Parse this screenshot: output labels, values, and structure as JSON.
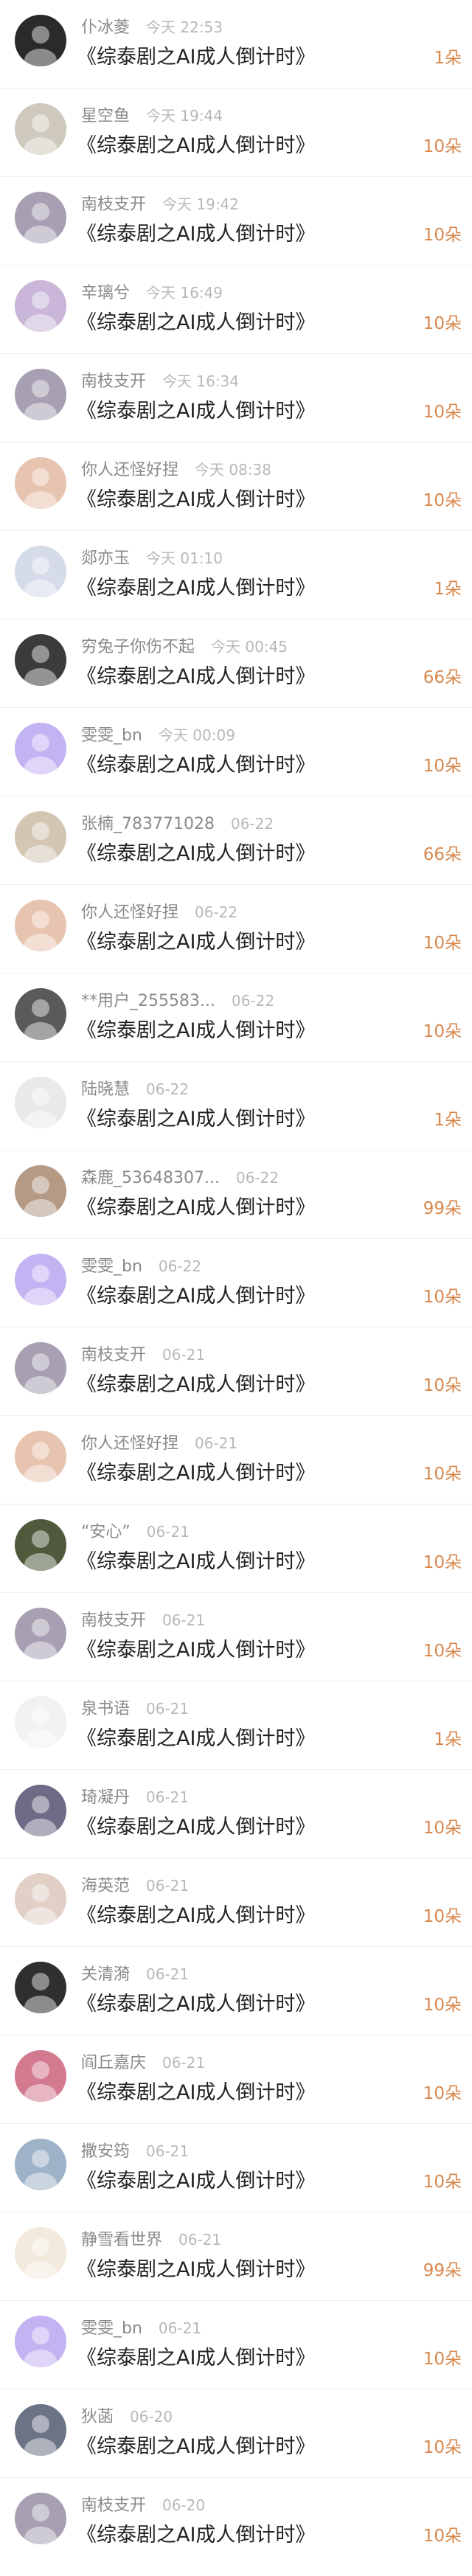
{
  "colors": {
    "gift_accent": "#d8874c",
    "name": "#8a8a8a",
    "time": "#b8b8b8",
    "title": "#222222"
  },
  "items": [
    {
      "name": "仆冰菱",
      "time": "今天 22:53",
      "title": "《综泰剧之AI成人倒计时》",
      "gift": "1朵",
      "avatar": "#2a2a2a"
    },
    {
      "name": "星空鱼",
      "time": "今天 19:44",
      "title": "《综泰剧之AI成人倒计时》",
      "gift": "10朵",
      "avatar": "#cfc8bd"
    },
    {
      "name": "南枝支开",
      "time": "今天 19:42",
      "title": "《综泰剧之AI成人倒计时》",
      "gift": "10朵",
      "avatar": "#a7a0b2"
    },
    {
      "name": "辛璃兮",
      "time": "今天 16:49",
      "title": "《综泰剧之AI成人倒计时》",
      "gift": "10朵",
      "avatar": "#c9b6d9"
    },
    {
      "name": "南枝支开",
      "time": "今天 16:34",
      "title": "《综泰剧之AI成人倒计时》",
      "gift": "10朵",
      "avatar": "#a7a0b2"
    },
    {
      "name": "你人还怪好捏",
      "time": "今天 08:38",
      "title": "《综泰剧之AI成人倒计时》",
      "gift": "10朵",
      "avatar": "#e7c4b0"
    },
    {
      "name": "郯亦玉",
      "time": "今天 01:10",
      "title": "《综泰剧之AI成人倒计时》",
      "gift": "1朵",
      "avatar": "#d6dbe9"
    },
    {
      "name": "穷兔子你伤不起",
      "time": "今天 00:45",
      "title": "《综泰剧之AI成人倒计时》",
      "gift": "66朵",
      "avatar": "#3b3b3b"
    },
    {
      "name": "雯雯_bn",
      "time": "今天 00:09",
      "title": "《综泰剧之AI成人倒计时》",
      "gift": "10朵",
      "avatar": "#c4b3f2"
    },
    {
      "name": "张楠_783771028",
      "time": "06-22",
      "title": "《综泰剧之AI成人倒计时》",
      "gift": "66朵",
      "avatar": "#d3c7b4"
    },
    {
      "name": "你人还怪好捏",
      "time": "06-22",
      "title": "《综泰剧之AI成人倒计时》",
      "gift": "10朵",
      "avatar": "#e7c4b0"
    },
    {
      "name": "**用户_255583...",
      "time": "06-22",
      "title": "《综泰剧之AI成人倒计时》",
      "gift": "10朵",
      "avatar": "#5a5a5a"
    },
    {
      "name": "陆晓慧",
      "time": "06-22",
      "title": "《综泰剧之AI成人倒计时》",
      "gift": "1朵",
      "avatar": "#e9e9e9"
    },
    {
      "name": "森鹿_53648307...",
      "time": "06-22",
      "title": "《综泰剧之AI成人倒计时》",
      "gift": "99朵",
      "avatar": "#b59a86"
    },
    {
      "name": "雯雯_bn",
      "time": "06-22",
      "title": "《综泰剧之AI成人倒计时》",
      "gift": "10朵",
      "avatar": "#c4b3f2"
    },
    {
      "name": "南枝支开",
      "time": "06-21",
      "title": "《综泰剧之AI成人倒计时》",
      "gift": "10朵",
      "avatar": "#a7a0b2"
    },
    {
      "name": "你人还怪好捏",
      "time": "06-21",
      "title": "《综泰剧之AI成人倒计时》",
      "gift": "10朵",
      "avatar": "#e7c4b0"
    },
    {
      "name": "“安心”",
      "time": "06-21",
      "title": "《综泰剧之AI成人倒计时》",
      "gift": "10朵",
      "avatar": "#4f5a3c"
    },
    {
      "name": "南枝支开",
      "time": "06-21",
      "title": "《综泰剧之AI成人倒计时》",
      "gift": "10朵",
      "avatar": "#a7a0b2"
    },
    {
      "name": "泉书语",
      "time": "06-21",
      "title": "《综泰剧之AI成人倒计时》",
      "gift": "1朵",
      "avatar": "#f2f2f2"
    },
    {
      "name": "琦凝丹",
      "time": "06-21",
      "title": "《综泰剧之AI成人倒计时》",
      "gift": "10朵",
      "avatar": "#6f6a86"
    },
    {
      "name": "海英范",
      "time": "06-21",
      "title": "《综泰剧之AI成人倒计时》",
      "gift": "10朵",
      "avatar": "#e2cfc6"
    },
    {
      "name": "关清漪",
      "time": "06-21",
      "title": "《综泰剧之AI成人倒计时》",
      "gift": "10朵",
      "avatar": "#2f2f2f"
    },
    {
      "name": "阎丘嘉庆",
      "time": "06-21",
      "title": "《综泰剧之AI成人倒计时》",
      "gift": "10朵",
      "avatar": "#d47a90"
    },
    {
      "name": "撒安筠",
      "time": "06-21",
      "title": "《综泰剧之AI成人倒计时》",
      "gift": "10朵",
      "avatar": "#9fb3c8"
    },
    {
      "name": "静雪看世界",
      "time": "06-21",
      "title": "《综泰剧之AI成人倒计时》",
      "gift": "99朵",
      "avatar": "#f3e9dc"
    },
    {
      "name": "雯雯_bn",
      "time": "06-21",
      "title": "《综泰剧之AI成人倒计时》",
      "gift": "10朵",
      "avatar": "#c4b3f2"
    },
    {
      "name": "狄菡",
      "time": "06-20",
      "title": "《综泰剧之AI成人倒计时》",
      "gift": "10朵",
      "avatar": "#6b7386"
    },
    {
      "name": "南枝支开",
      "time": "06-20",
      "title": "《综泰剧之AI成人倒计时》",
      "gift": "10朵",
      "avatar": "#a7a0b2"
    }
  ]
}
